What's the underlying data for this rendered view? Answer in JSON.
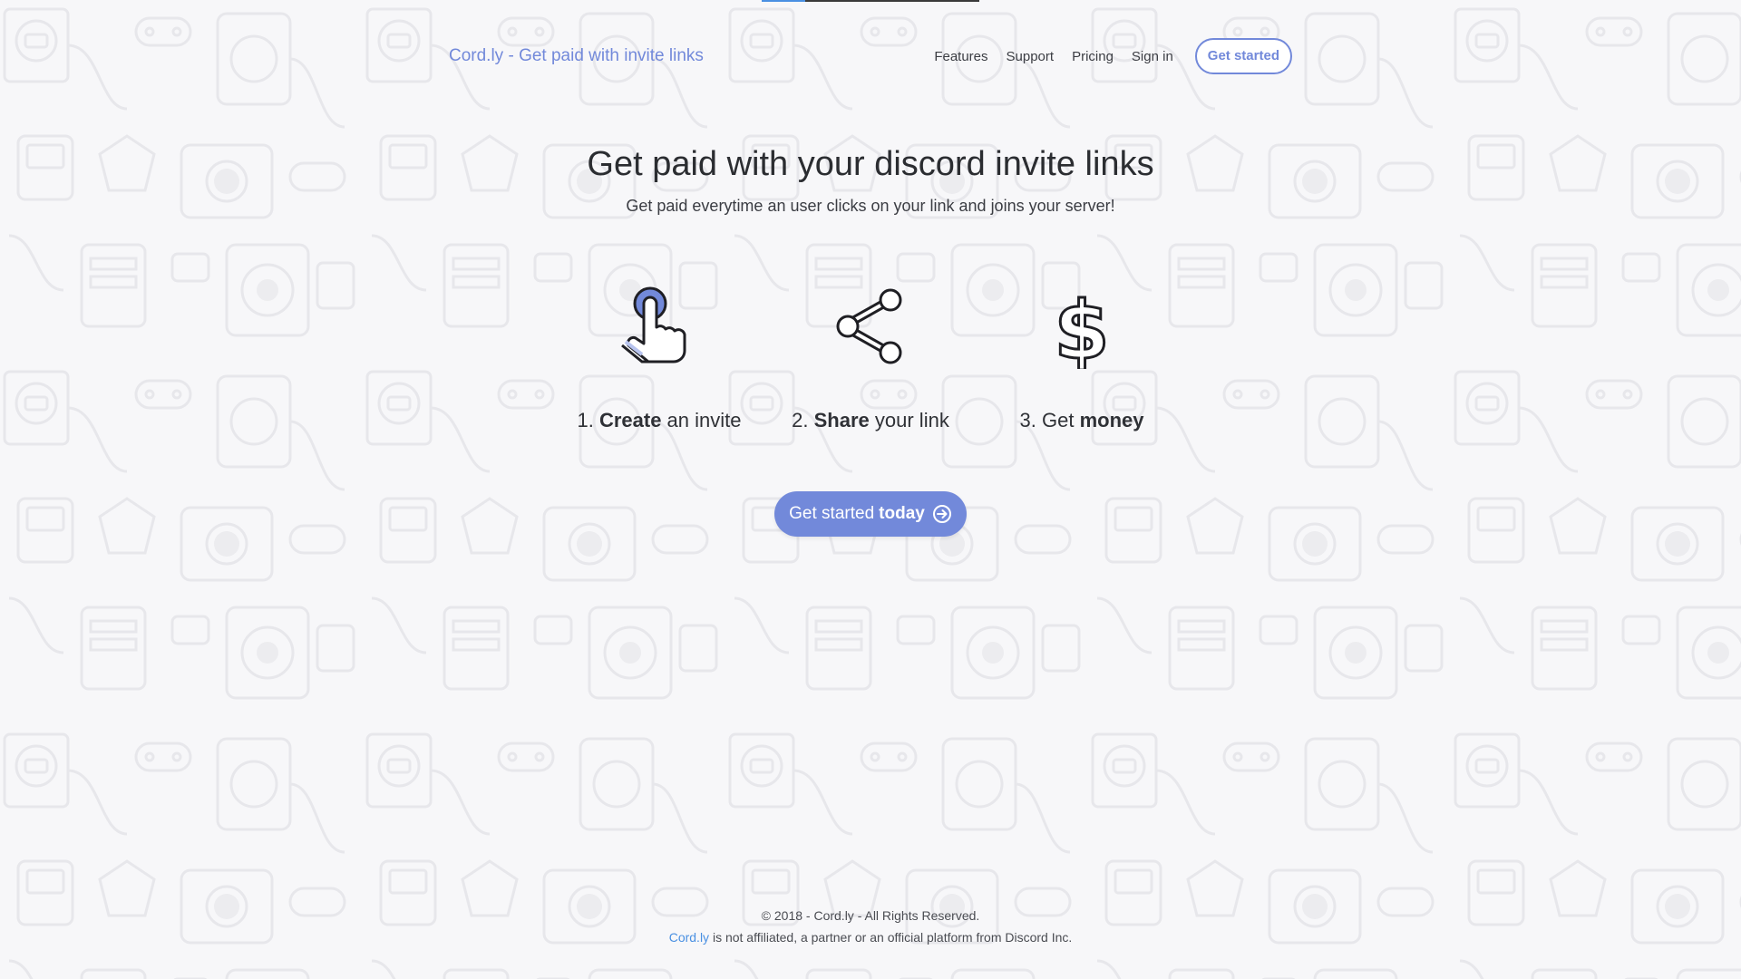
{
  "top_progress": 0.2,
  "header": {
    "brand": "Cord.ly - Get paid with invite links",
    "nav": [
      "Features",
      "Support",
      "Pricing",
      "Sign in"
    ],
    "cta": "Get started"
  },
  "hero": {
    "title": "Get paid with your discord invite links",
    "subtitle": "Get paid everytime an user clicks on your link and joins your server!"
  },
  "steps": [
    {
      "prefix": "1. ",
      "bold": "Create",
      "suffix": " an invite",
      "icon": "tap-hand-icon"
    },
    {
      "prefix": "2. ",
      "bold": "Share",
      "suffix": " your link",
      "icon": "share-icon"
    },
    {
      "prefix": "3. Get ",
      "bold": "money",
      "suffix": "",
      "icon": "dollar-icon"
    }
  ],
  "cta_big": {
    "text": "Get started",
    "bold": "today",
    "icon": "arrow-right-circle-icon"
  },
  "footer": {
    "copyright": "© 2018 - Cord.ly - All Rights Reserved.",
    "brand_link": "Cord.ly",
    "disclaimer": " is not affiliated, a partner or an official platform from Discord Inc."
  },
  "colors": {
    "accent": "#7289da",
    "background": "#f7f7f9",
    "link": "#4a90e2"
  }
}
